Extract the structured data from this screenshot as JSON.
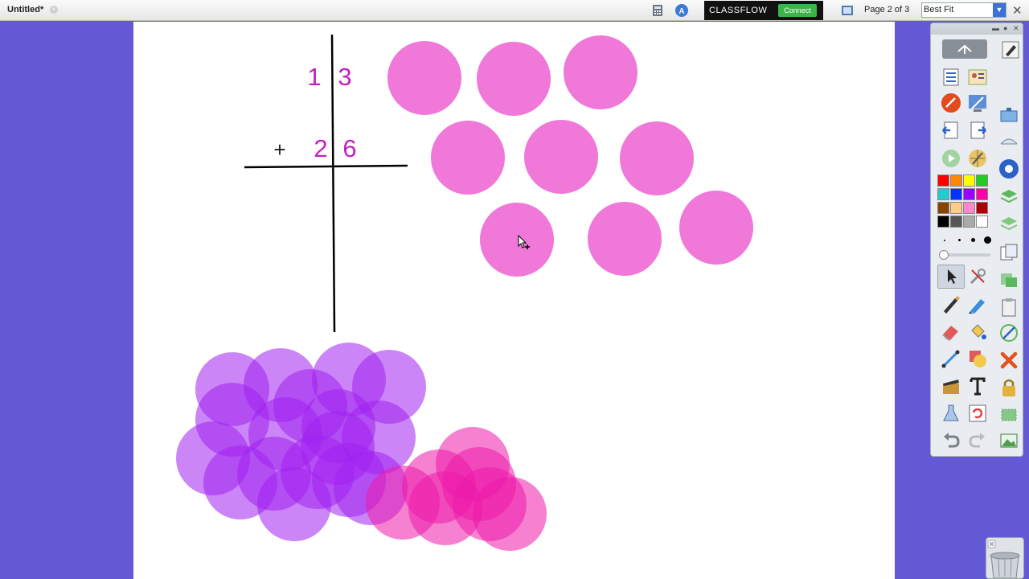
{
  "window": {
    "title": "Untitled*"
  },
  "classflow": {
    "logo": "CLASSFLOW",
    "connect_label": "Connect"
  },
  "pager": {
    "page_label": "Page 2 of 3"
  },
  "zoom": {
    "selected": "Best Fit"
  },
  "flipchart": {
    "top_digits": [
      "1",
      "3"
    ],
    "bottom_digits": [
      "2",
      "6"
    ],
    "operator": "+"
  },
  "colors": {
    "background": "#6459d4",
    "pink_circle": "#ef78d8",
    "purple_circle": "#a020f0",
    "magenta_circle": "#ec1aaa",
    "digit": "#c41fc0"
  },
  "palette": [
    "#ff0000",
    "#ff8800",
    "#ffff00",
    "#22cc22",
    "#22cccc",
    "#0033ff",
    "#9900ff",
    "#ff00aa",
    "#884400",
    "#ffcc88",
    "#ff88cc",
    "#aa0000",
    "#000000",
    "#555555",
    "#aaaaaa",
    "#ffffff"
  ],
  "icons": [
    "new-page-icon",
    "pen-icon",
    "highlighter-icon",
    "eraser-icon",
    "text-icon",
    "select-icon",
    "undo-icon",
    "redo-icon",
    "delete-icon",
    "lock-icon",
    "trash-icon"
  ]
}
